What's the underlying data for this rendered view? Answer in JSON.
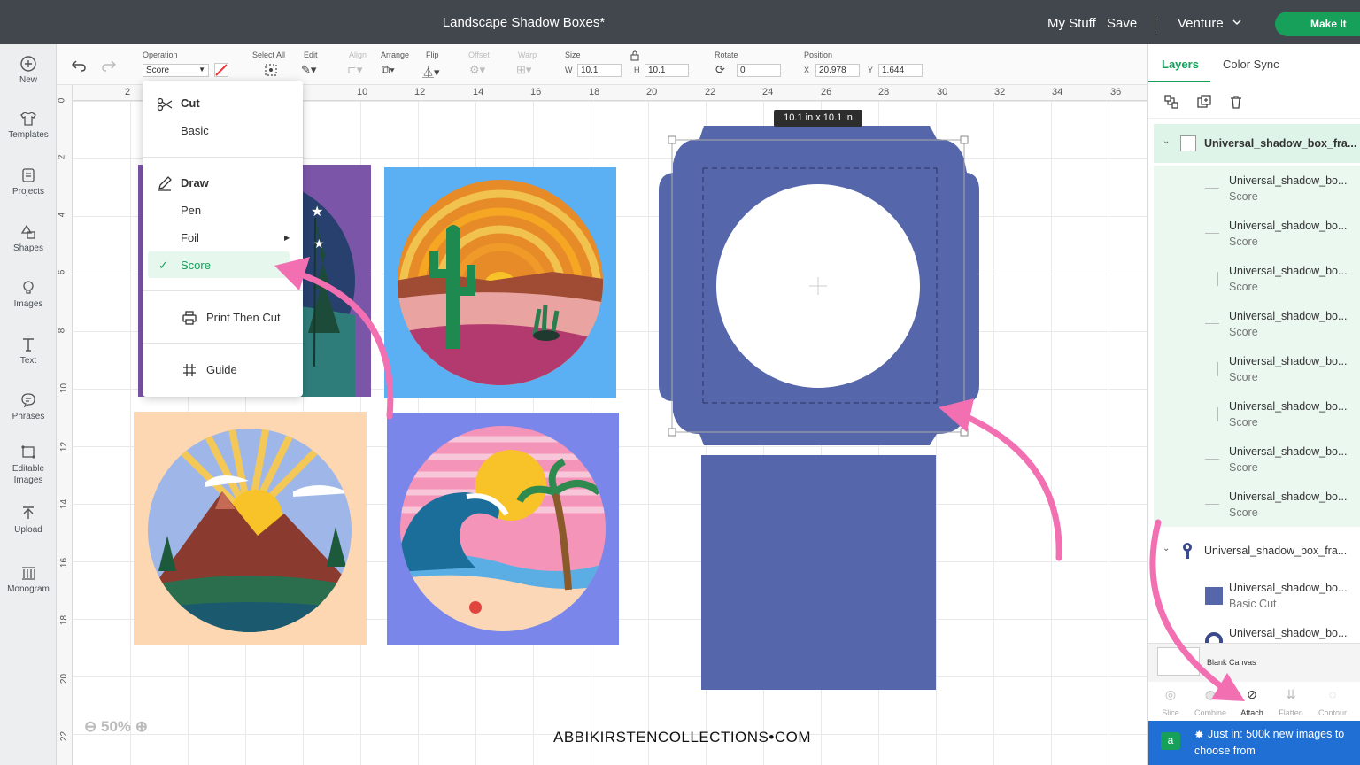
{
  "titlebar": {
    "title": "Landscape Shadow Boxes*",
    "my_stuff": "My Stuff",
    "save": "Save",
    "machine": "Venture",
    "make_it": "Make It"
  },
  "leftnav": [
    {
      "label": "New",
      "icon": "plus-circle-icon"
    },
    {
      "label": "Templates",
      "icon": "shirt-icon"
    },
    {
      "label": "Projects",
      "icon": "projects-icon"
    },
    {
      "label": "Shapes",
      "icon": "shapes-icon"
    },
    {
      "label": "Images",
      "icon": "lightbulb-icon"
    },
    {
      "label": "Text",
      "icon": "text-icon"
    },
    {
      "label": "Phrases",
      "icon": "chat-icon"
    },
    {
      "label": "Editable Images",
      "icon": "editable-image-icon"
    },
    {
      "label": "Upload",
      "icon": "upload-icon"
    },
    {
      "label": "Monogram",
      "icon": "monogram-icon"
    }
  ],
  "toolbar": {
    "operation_label": "Operation",
    "operation_value": "Score",
    "select_all": "Select All",
    "edit": "Edit",
    "align": "Align",
    "arrange": "Arrange",
    "flip": "Flip",
    "offset": "Offset",
    "warp": "Warp",
    "size": "Size",
    "w_label": "W",
    "w_value": "10.1",
    "h_label": "H",
    "h_value": "10.1",
    "rotate": "Rotate",
    "rotate_value": "0",
    "position": "Position",
    "x_label": "X",
    "x_value": "20.978",
    "y_label": "Y",
    "y_value": "1.644"
  },
  "ruler": {
    "top": [
      "2",
      "10",
      "12",
      "14",
      "16",
      "18",
      "20",
      "22",
      "24",
      "26",
      "28",
      "30",
      "32",
      "34",
      "36"
    ],
    "left": [
      "0",
      "2",
      "4",
      "6",
      "8",
      "10",
      "12",
      "14",
      "16",
      "18",
      "20",
      "22"
    ]
  },
  "dropdown": {
    "cut": "Cut",
    "basic": "Basic",
    "draw": "Draw",
    "pen": "Pen",
    "foil": "Foil",
    "score": "Score",
    "print_then_cut": "Print Then Cut",
    "guide": "Guide"
  },
  "canvas": {
    "size_tooltip": "10.1  in x 10.1  in",
    "zoom": "50%",
    "watermark": "ABBIKIRSTENCOLLECTIONS",
    "watermark_dot": "•",
    "watermark_tld": "COM"
  },
  "panel": {
    "tab_layers": "Layers",
    "tab_color_sync": "Color Sync",
    "group1": "Universal_shadow_box_fra...",
    "group1_layers": [
      {
        "name": "Universal_shadow_bo...",
        "op": "Score"
      },
      {
        "name": "Universal_shadow_bo...",
        "op": "Score"
      },
      {
        "name": "Universal_shadow_bo...",
        "op": "Score"
      },
      {
        "name": "Universal_shadow_bo...",
        "op": "Score"
      },
      {
        "name": "Universal_shadow_bo...",
        "op": "Score"
      },
      {
        "name": "Universal_shadow_bo...",
        "op": "Score"
      },
      {
        "name": "Universal_shadow_bo...",
        "op": "Score"
      },
      {
        "name": "Universal_shadow_bo...",
        "op": "Score"
      }
    ],
    "group2": "Universal_shadow_box_fra...",
    "group2_layers": [
      {
        "name": "Universal_shadow_bo...",
        "op": "Basic Cut"
      },
      {
        "name": "Universal_shadow_bo...",
        "op": ""
      }
    ],
    "blank_canvas": "Blank Canvas",
    "tools": [
      "Slice",
      "Combine",
      "Attach",
      "Flatten",
      "Contour"
    ],
    "promo_line1": "Just in: 500k new images to",
    "promo_line2": "choose from"
  },
  "colors": {
    "accent": "#16a05a",
    "shape_blue": "#5566aa",
    "annotation_pink": "#f26fb2",
    "titlebar": "#41474d"
  }
}
